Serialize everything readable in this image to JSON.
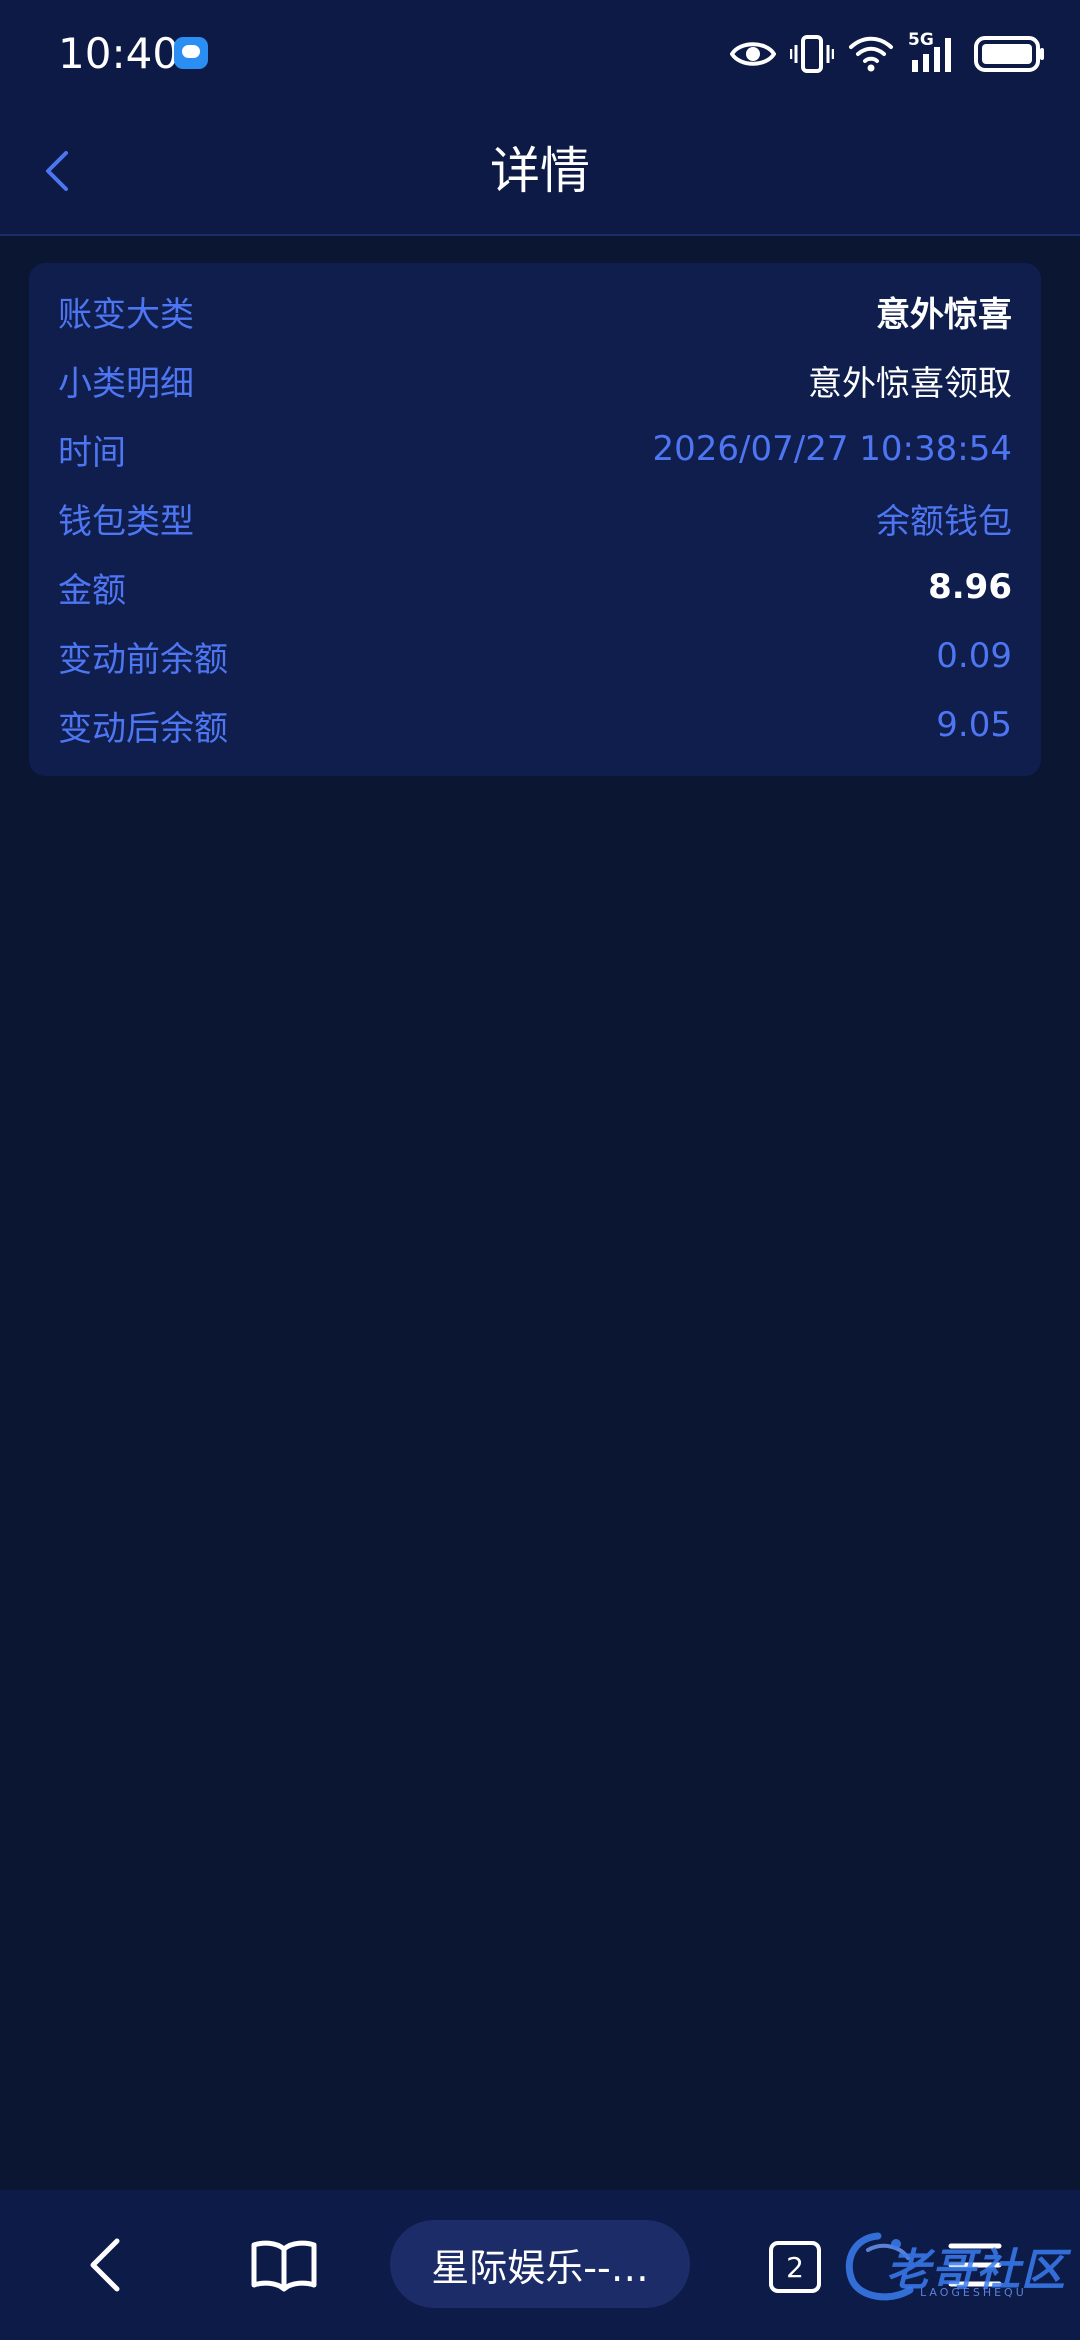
{
  "status_bar": {
    "time": "10:40",
    "network_label": "5G"
  },
  "header": {
    "title": "详情"
  },
  "details": [
    {
      "label": "账变大类",
      "value": "意外惊喜"
    },
    {
      "label": "小类明细",
      "value": "意外惊喜领取"
    },
    {
      "label": "时间",
      "value": "2026/07/27 10:38:54"
    },
    {
      "label": "钱包类型",
      "value": "余额钱包"
    },
    {
      "label": "金额",
      "value": "8.96"
    },
    {
      "label": "变动前余额",
      "value": "0.09"
    },
    {
      "label": "变动后余额",
      "value": "9.05"
    }
  ],
  "browser_bar": {
    "url_title": "星际娱乐--…",
    "tab_count": "2"
  },
  "watermark": {
    "text": "老哥社区",
    "subtext": "LAOGESHEQU"
  },
  "colors": {
    "background": "#0b1633",
    "header_bg": "#0c1a45",
    "card_bg": "#0f1e4d",
    "accent_blue": "#4e76f2",
    "text_white": "#ffffff"
  },
  "icons": {
    "status": [
      "message-icon",
      "eye-icon",
      "vibrate-icon",
      "wifi-icon",
      "signal-icon",
      "battery-icon"
    ],
    "nav": [
      "chevron-left-icon"
    ],
    "browser": [
      "back-arrow-icon",
      "book-icon",
      "tabs-icon",
      "menu-icon"
    ]
  }
}
